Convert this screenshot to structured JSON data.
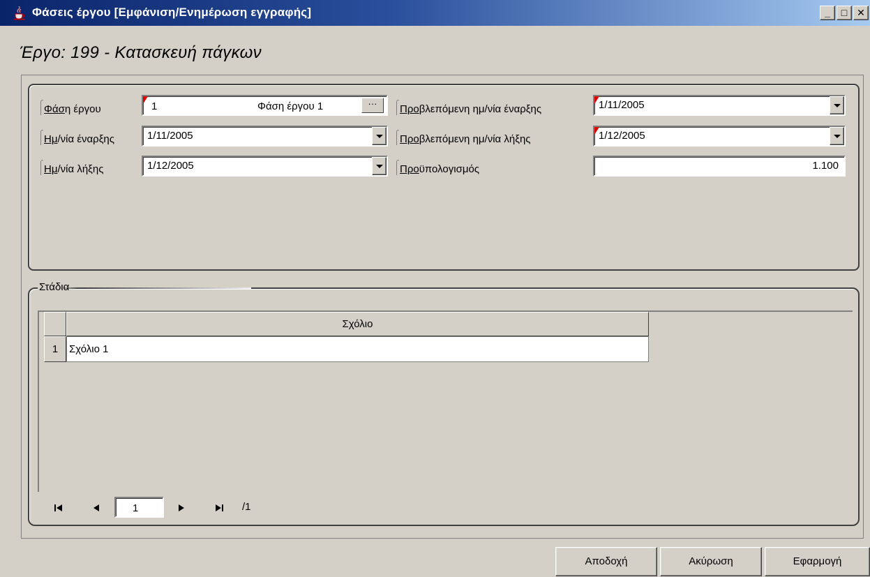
{
  "window": {
    "title": "Φάσεις έργου [Εμφάνιση/Ενημέρωση  εγγραφής]",
    "minimize_label": "_",
    "maximize_label": "□",
    "close_label": "✕"
  },
  "project_heading": "Έργο: 199 - Κατασκευή πάγκων",
  "form": {
    "phase": {
      "label_mnemonic": "Φάσ",
      "label_rest": "η έργου",
      "code": "1",
      "description": "Φάση έργου 1",
      "lookup_label": "···"
    },
    "start_date": {
      "label_mnemonic": "Ημ",
      "label_rest": "/νία έναρξης",
      "value": "1/11/2005"
    },
    "end_date": {
      "label_mnemonic": "Ημ",
      "label_rest": "/νία λήξης",
      "value": "1/12/2005"
    },
    "planned_start": {
      "label_mnemonic": "Προ",
      "label_rest": "βλεπόμενη ημ/νία έναρξης",
      "value": "1/11/2005"
    },
    "planned_end": {
      "label_mnemonic": "Προ",
      "label_rest": "βλεπόμενη ημ/νία λήξης",
      "value": "1/12/2005"
    },
    "budget": {
      "label_mnemonic": "Προ",
      "label_rest": "ϋπολογισμός",
      "value": "1.100"
    }
  },
  "stages": {
    "title": "Στάδια",
    "columns": [
      "Σχόλιο"
    ],
    "rows": [
      {
        "num": "1",
        "comment": "Σχόλιο 1"
      }
    ],
    "pager": {
      "first_icon": "first-page-icon",
      "prev_icon": "prev-page-icon",
      "next_icon": "next-page-icon",
      "last_icon": "last-page-icon",
      "current_page": "1",
      "total": "/1"
    }
  },
  "buttons": {
    "accept": "Αποδοχή",
    "cancel": "Ακύρωση",
    "apply": "Εφαρμογή"
  },
  "colors": {
    "titlebar_start": "#0a246a",
    "titlebar_end": "#a6caf0",
    "window_bg": "#d4d0c8",
    "required_marker": "#e00000"
  }
}
